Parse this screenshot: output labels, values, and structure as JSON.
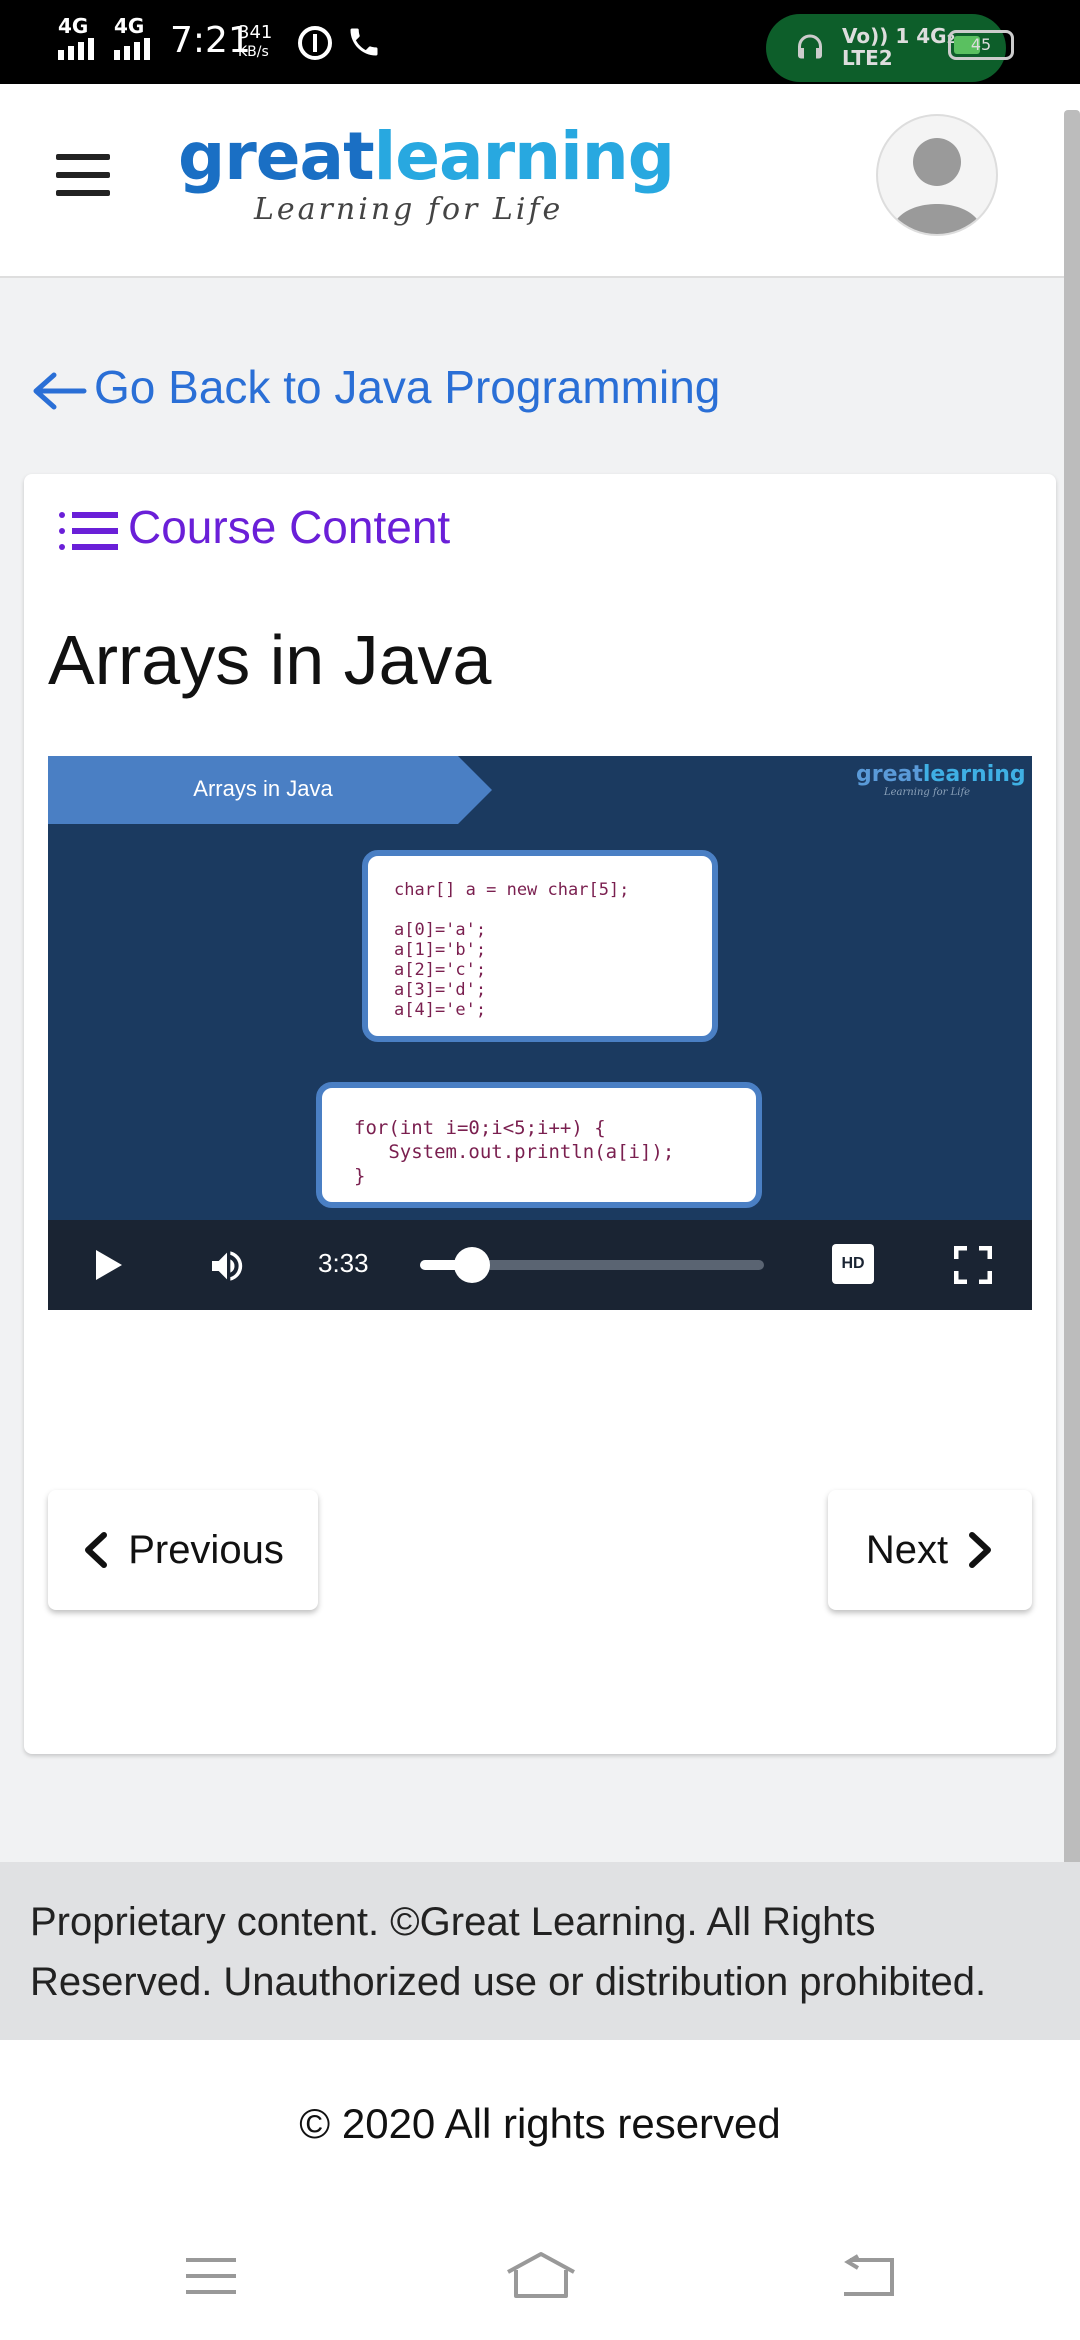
{
  "status_bar": {
    "network_1": "4G",
    "network_2": "4G",
    "time": "7:21",
    "speed_value": "341",
    "speed_unit": "KB/s",
    "carrier_top": "Vo)) 1 4G₂",
    "carrier_bottom": "LTE2",
    "battery": "45"
  },
  "header": {
    "logo_part1": "great",
    "logo_part2": "learning",
    "logo_tagline": "Learning for Life",
    "menu_icon": "hamburger-icon",
    "avatar_icon": "user-avatar-icon"
  },
  "nav": {
    "back_label": "Go Back to Java Programming",
    "back_icon": "arrow-left-icon"
  },
  "course": {
    "content_label": "Course Content",
    "content_icon": "list-icon",
    "lesson_title": "Arrays in Java"
  },
  "video": {
    "ribbon_title": "Arrays in Java",
    "watermark_part1": "great",
    "watermark_part2": "learning",
    "watermark_tagline": "Learning for Life",
    "code_top": "char[] a = new char[5];\n\na[0]='a';\na[1]='b';\na[2]='c';\na[3]='d';\na[4]='e';",
    "code_bottom": "for(int i=0;i<5;i++) {\n   System.out.println(a[i]);\n}",
    "current_time": "3:33",
    "progress": 0.15,
    "hd_label": "HD"
  },
  "pagination": {
    "previous_label": "Previous",
    "next_label": "Next"
  },
  "footer": {
    "notice": "Proprietary content. ©Great Learning. All Rights Reserved. Unauthorized use or distribution prohibited.",
    "copyright": "© 2020 All rights reserved"
  },
  "colors": {
    "brand_blue": "#1a6fc4",
    "brand_light": "#28a8e0",
    "link_blue": "#2a6fd6",
    "course_purple": "#6a1fd8",
    "video_bg": "#1b3a60"
  }
}
